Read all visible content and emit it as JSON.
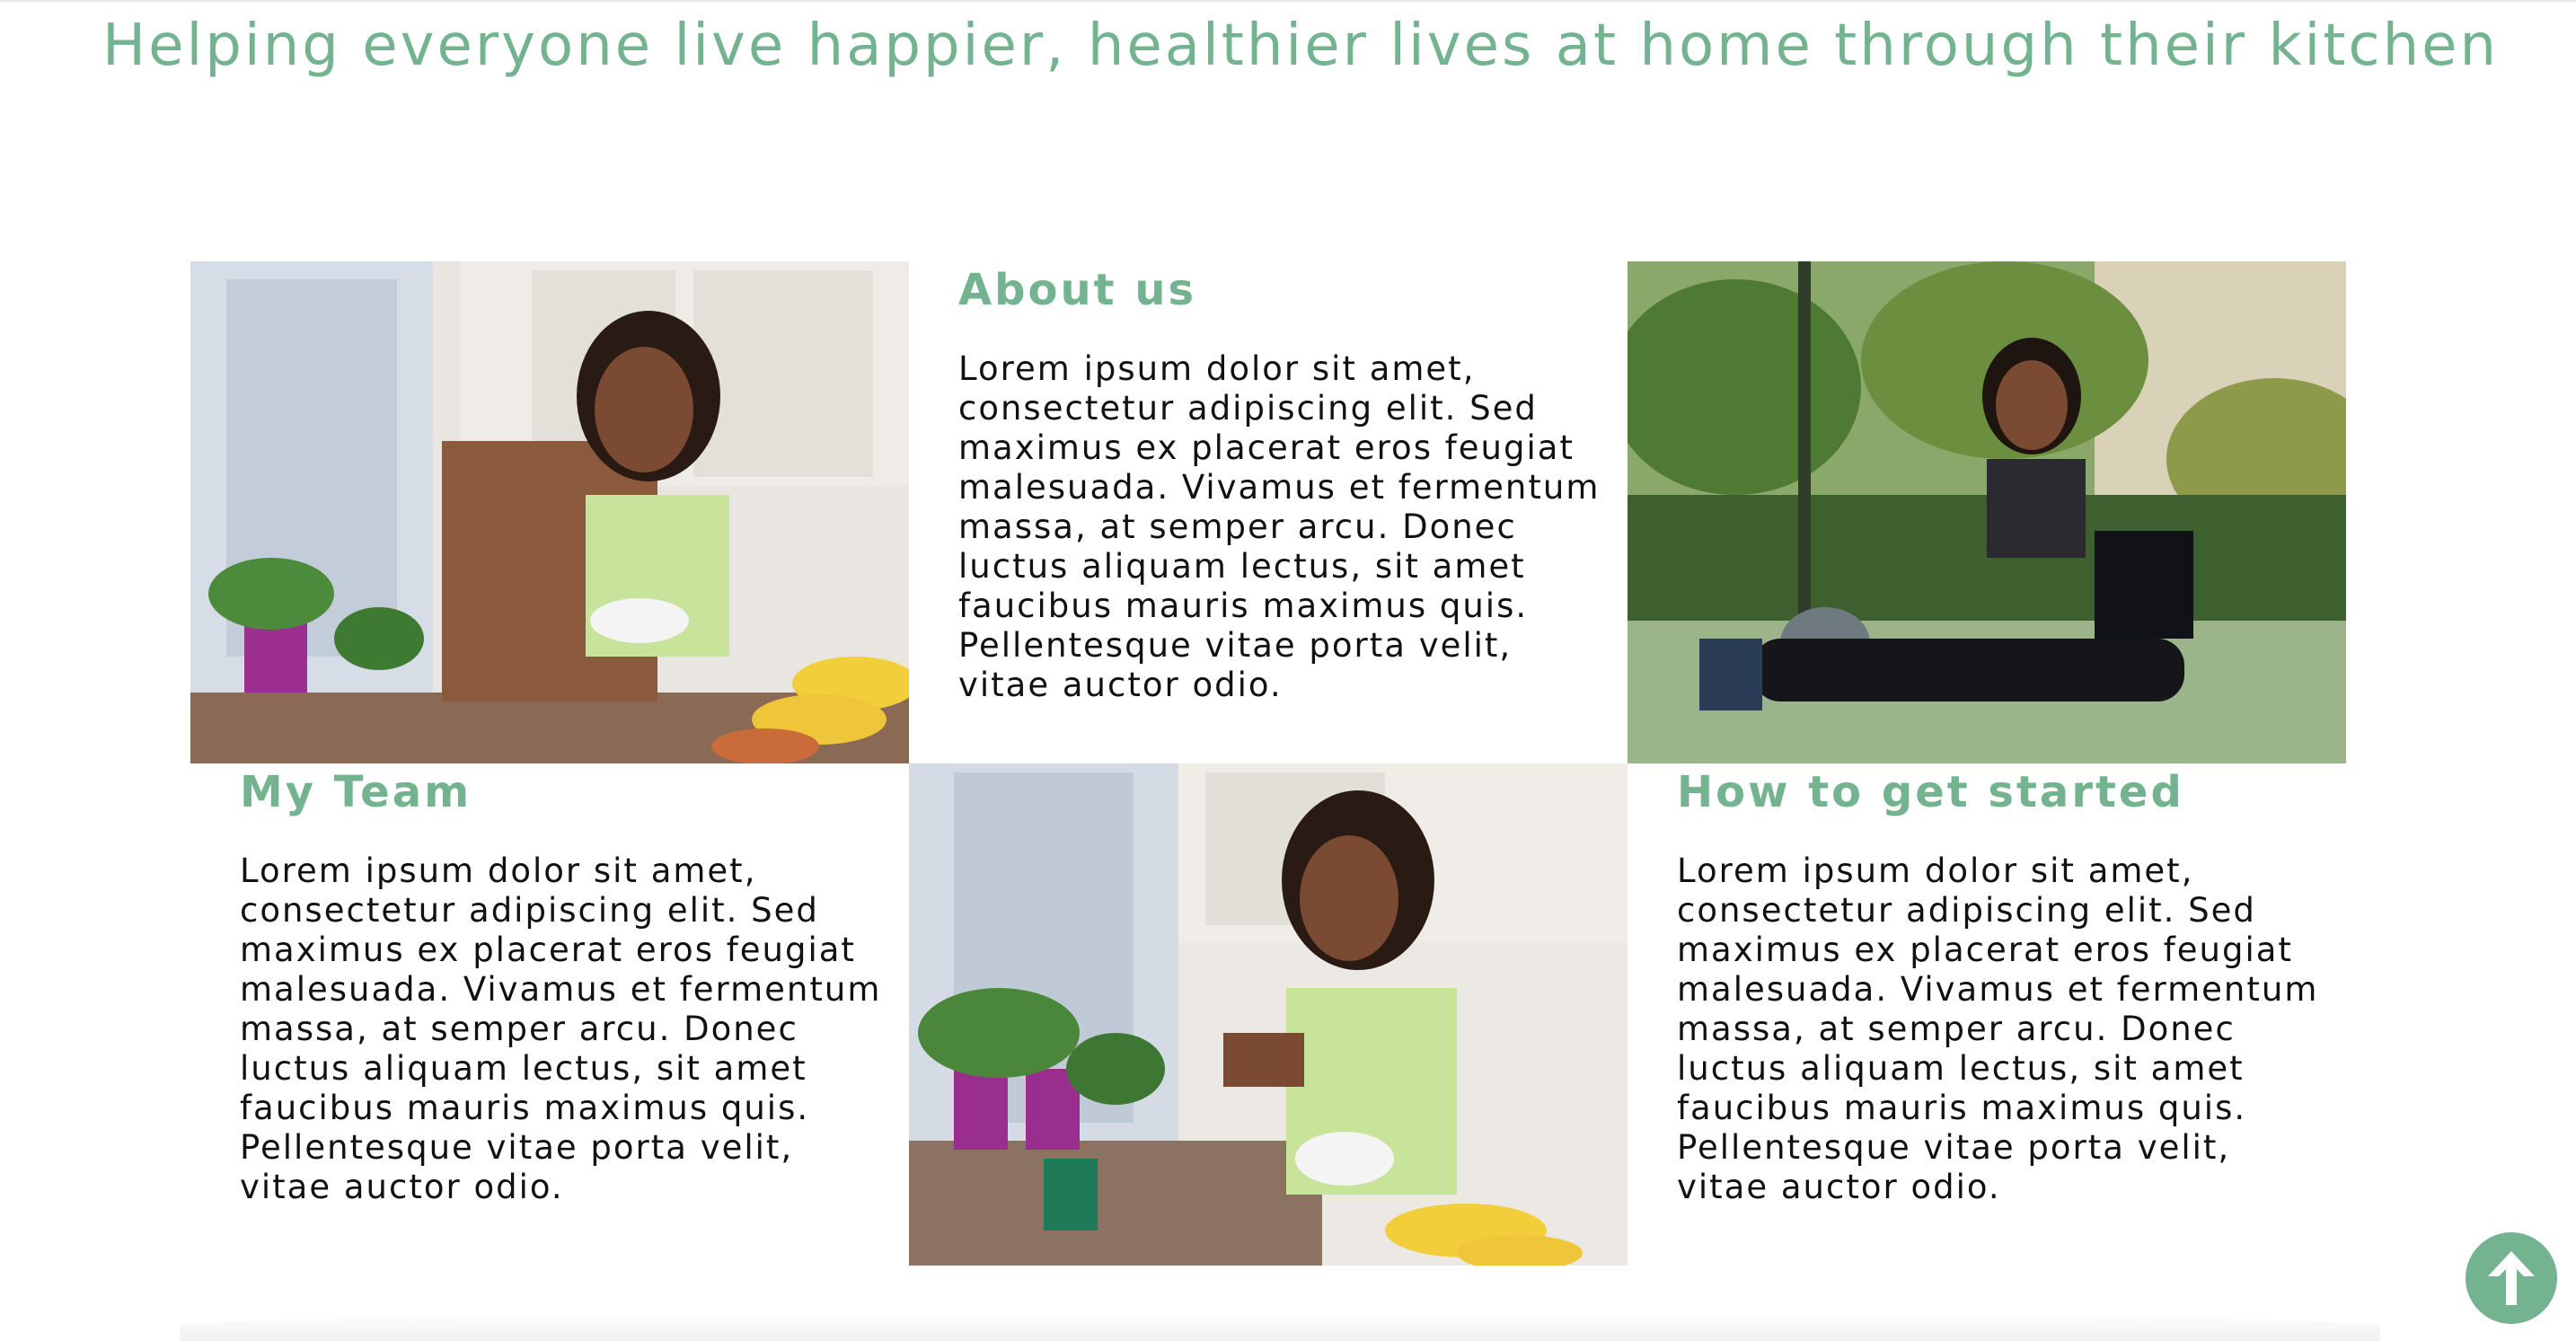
{
  "header": {
    "tagline": "Helping everyone live happier, healthier lives at home through their kitchen"
  },
  "sections": [
    {
      "title": "About us",
      "body": "Lorem ipsum dolor sit amet, consectetur adipiscing elit. Sed maximus ex placerat eros feugiat malesuada. Vivamus et fermentum massa, at semper arcu. Donec luctus aliquam lectus, sit amet faucibus mauris maximus quis. Pellentesque vitae porta velit, vitae auctor odio."
    },
    {
      "title": "My Team",
      "body": "Lorem ipsum dolor sit amet, consectetur adipiscing elit. Sed maximus ex placerat eros feugiat malesuada. Vivamus et fermentum massa, at semper arcu. Donec luctus aliquam lectus, sit amet faucibus mauris maximus quis. Pellentesque vitae porta velit, vitae auctor odio."
    },
    {
      "title": "How to get started",
      "body": "Lorem ipsum dolor sit amet, consectetur adipiscing elit. Sed maximus ex placerat eros feugiat malesuada. Vivamus et fermentum massa, at semper arcu. Donec luctus aliquam lectus, sit amet faucibus mauris maximus quis. Pellentesque vitae porta velit, vitae auctor odio."
    }
  ],
  "icons": {
    "scroll_top": "arrow-up-icon"
  },
  "colors": {
    "accent": "#73b38f",
    "text": "#111111",
    "background": "#ffffff"
  }
}
